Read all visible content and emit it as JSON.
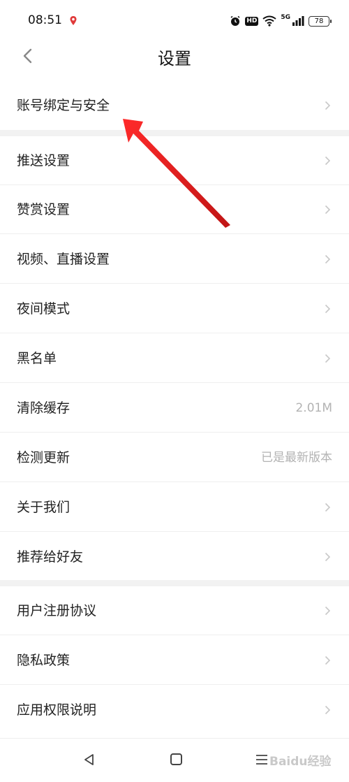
{
  "status_bar": {
    "time": "08:51",
    "hd": "HD",
    "network": "5G",
    "battery": "78"
  },
  "header": {
    "title": "设置"
  },
  "settings": {
    "section1": [
      {
        "label": "账号绑定与安全",
        "value": "",
        "chevron": true
      }
    ],
    "section2": [
      {
        "label": "推送设置",
        "value": "",
        "chevron": true
      },
      {
        "label": "赞赏设置",
        "value": "",
        "chevron": true
      },
      {
        "label": "视频、直播设置",
        "value": "",
        "chevron": true
      },
      {
        "label": "夜间模式",
        "value": "",
        "chevron": true
      },
      {
        "label": "黑名单",
        "value": "",
        "chevron": true
      },
      {
        "label": "清除缓存",
        "value": "2.01M",
        "chevron": false
      },
      {
        "label": "检测更新",
        "value": "已是最新版本",
        "chevron": false
      },
      {
        "label": "关于我们",
        "value": "",
        "chevron": true
      },
      {
        "label": "推荐给好友",
        "value": "",
        "chevron": true
      }
    ],
    "section3": [
      {
        "label": "用户注册协议",
        "value": "",
        "chevron": true
      },
      {
        "label": "隐私政策",
        "value": "",
        "chevron": true
      },
      {
        "label": "应用权限说明",
        "value": "",
        "chevron": true
      }
    ]
  },
  "nav_bar": {
    "icons": [
      "back-triangle-icon",
      "home-square-icon",
      "menu-lines-icon"
    ]
  },
  "watermark": "Baidu经验",
  "colors": {
    "background": "#ffffff",
    "separator": "#f2f2f2",
    "secondary_text": "#b3b3b3",
    "annotation_arrow": "#e02020"
  }
}
